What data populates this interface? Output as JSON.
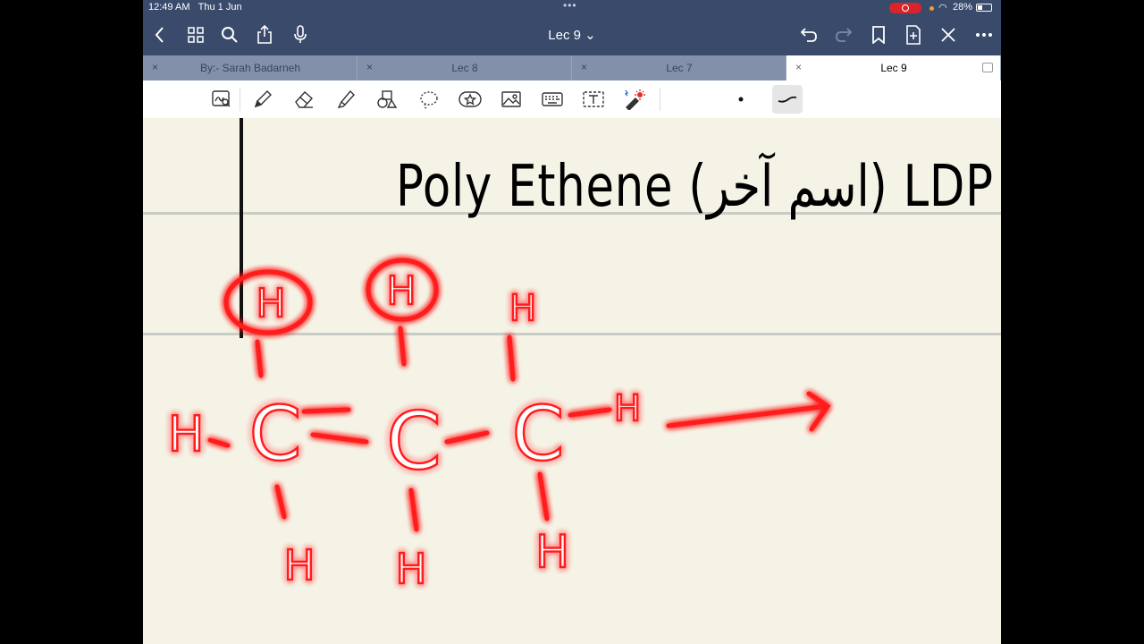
{
  "status": {
    "time": "12:49 AM",
    "date": "Thu 1 Jun",
    "battery": "28%"
  },
  "nav": {
    "title": "Lec 9 ⌄"
  },
  "tabs": [
    {
      "label": "By:- Sarah Badarneh",
      "close": "×"
    },
    {
      "label": "Lec 8",
      "close": "×"
    },
    {
      "label": "Lec 7",
      "close": "×"
    },
    {
      "label": "Lec 9",
      "close": "×"
    }
  ],
  "note": {
    "title": "Poly Ethene (اسم آخر) LDP",
    "molecule": {
      "top_h": [
        "H",
        "H",
        "H"
      ],
      "bottom_h": [
        "H",
        "H",
        "H"
      ],
      "left_h": "H",
      "right_h": "H",
      "carbons": [
        "C",
        "C",
        "C"
      ]
    }
  },
  "icons": {
    "back": "chevron-left-icon",
    "grid": "grid-icon",
    "search": "search-icon",
    "share": "share-icon",
    "mic": "microphone-icon",
    "undo": "undo-icon",
    "redo": "redo-icon",
    "bookmark": "bookmark-icon",
    "add-page": "add-page-icon",
    "close": "close-icon",
    "more": "more-icon"
  }
}
